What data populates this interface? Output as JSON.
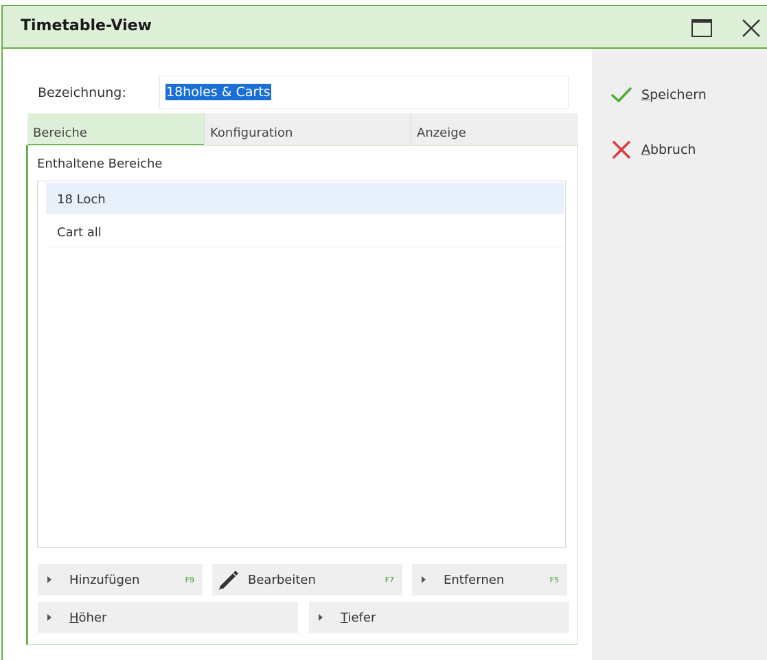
{
  "window": {
    "title": "Timetable-View"
  },
  "form": {
    "label": "Bezeichnung:",
    "value": "18holes & Carts"
  },
  "tabs": [
    {
      "label": "Bereiche",
      "active": true
    },
    {
      "label": "Konfiguration",
      "active": false
    },
    {
      "label": "Anzeige",
      "active": false
    }
  ],
  "section": {
    "title": "Enthaltene Bereiche"
  },
  "list": {
    "items": [
      {
        "label": "18 Loch",
        "selected": true
      },
      {
        "label": "Cart all",
        "selected": false
      }
    ]
  },
  "buttons": {
    "add": {
      "label": "Hinzufügen",
      "key": "F9"
    },
    "edit": {
      "label": "Bearbeiten",
      "key": "F7"
    },
    "remove": {
      "label": "Entfernen",
      "key": "F5"
    },
    "up": {
      "first": "H",
      "rest": "öher"
    },
    "down": {
      "first": "T",
      "rest": "iefer"
    }
  },
  "actions": {
    "save": {
      "first": "S",
      "rest": "peichern"
    },
    "cancel": {
      "first": "A",
      "rest": "bbruch"
    }
  },
  "colors": {
    "accent_green": "#6aae4a",
    "titlebar_bg": "#dff0d8",
    "save_check": "#4caf32",
    "cancel_x": "#e0393e",
    "selection": "#1a6fd6"
  },
  "icons": {
    "maximize": "window-maximize-icon",
    "close": "close-icon",
    "save": "checkmark-icon",
    "cancel": "cross-icon",
    "edit": "pencil-icon",
    "expand": "triangle-right-icon"
  }
}
